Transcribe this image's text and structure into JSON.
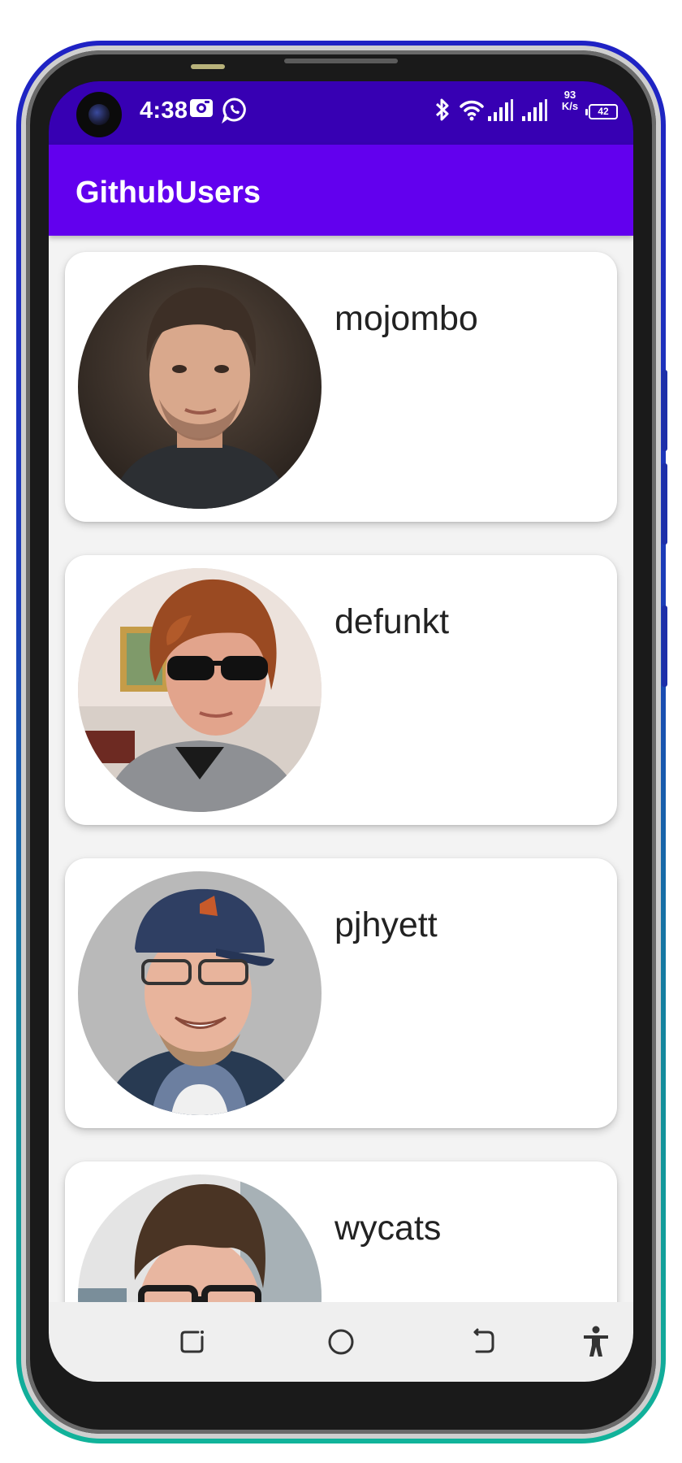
{
  "status_bar": {
    "time": "4:38",
    "speed_value": "93",
    "speed_unit": "K/s",
    "battery": "42",
    "icons": [
      "notification-app-icon",
      "whatsapp-icon",
      "bluetooth-icon",
      "wifi-icon",
      "signal-icon",
      "signal-icon"
    ]
  },
  "app_bar": {
    "title": "GithubUsers"
  },
  "users": [
    {
      "login": "mojombo"
    },
    {
      "login": "defunkt"
    },
    {
      "login": "pjhyett"
    },
    {
      "login": "wycats"
    }
  ],
  "nav_bar": {
    "buttons": [
      "recents-icon",
      "home-icon",
      "back-icon",
      "accessibility-icon"
    ]
  },
  "colors": {
    "status_bar": "#3700b3",
    "app_bar": "#6200ee",
    "list_background": "#f3f3f3",
    "card": "#ffffff",
    "nav_bar": "#efefef"
  }
}
